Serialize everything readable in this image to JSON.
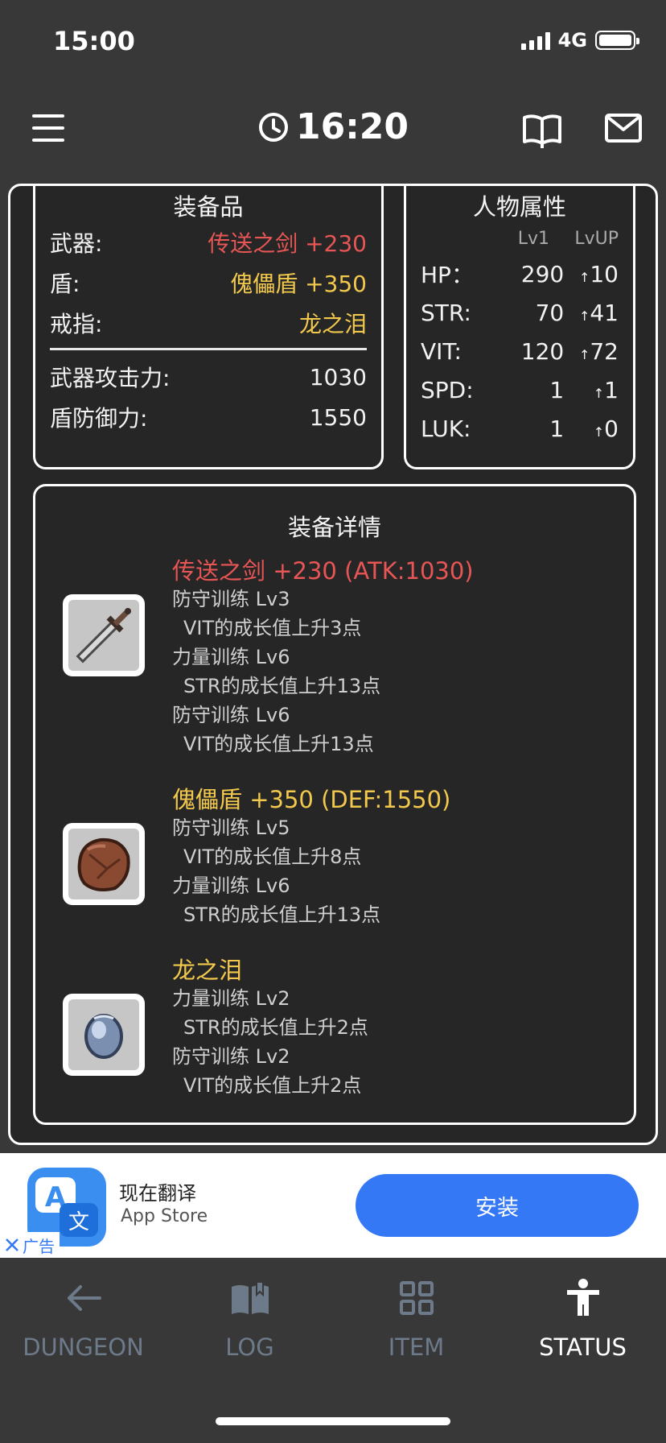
{
  "status_bar": {
    "time": "15:00",
    "network": "4G"
  },
  "header": {
    "game_time": "16:20"
  },
  "equipment": {
    "title": "装备品",
    "weapon_label": "武器:",
    "weapon_value": "传送之剑 +230",
    "shield_label": "盾:",
    "shield_value": "傀儡盾 +350",
    "ring_label": "戒指:",
    "ring_value": "龙之泪",
    "atk_label": "武器攻击力:",
    "atk_value": "1030",
    "def_label": "盾防御力:",
    "def_value": "1550"
  },
  "attributes": {
    "title": "人物属性",
    "col1": "Lv1",
    "col2": "LvUP",
    "rows": [
      {
        "key": "HP：",
        "base": "290",
        "up": "10"
      },
      {
        "key": "STR:",
        "base": "70",
        "up": "41"
      },
      {
        "key": "VIT:",
        "base": "120",
        "up": "72"
      },
      {
        "key": "SPD:",
        "base": "1",
        "up": "1"
      },
      {
        "key": "LUK:",
        "base": "1",
        "up": "0"
      }
    ]
  },
  "details": {
    "title": "装备详情",
    "items": [
      {
        "name": "传送之剑 +230 (ATK:1030)",
        "icon": "sword-icon",
        "lines": [
          "防守训练 Lv3",
          "VIT的成长值上升3点",
          "力量训练 Lv6",
          "STR的成长值上升13点",
          "防守训练 Lv6",
          "VIT的成长值上升13点"
        ]
      },
      {
        "name": "傀儡盾 +350 (DEF:1550)",
        "icon": "shield-icon",
        "lines": [
          "防守训练 Lv5",
          "VIT的成长值上升8点",
          "力量训练 Lv6",
          "STR的成长值上升13点"
        ]
      },
      {
        "name": "龙之泪",
        "icon": "gem-icon",
        "lines": [
          "力量训练 Lv2",
          "STR的成长值上升2点",
          "防守训练 Lv2",
          "VIT的成长值上升2点"
        ]
      }
    ]
  },
  "ad": {
    "title": "现在翻译",
    "subtitle": "App Store",
    "button": "安装",
    "tag": "广告"
  },
  "tabs": [
    {
      "label": "DUNGEON",
      "icon": "arrow-left-icon",
      "active": false
    },
    {
      "label": "LOG",
      "icon": "book-icon",
      "active": false
    },
    {
      "label": "ITEM",
      "icon": "grid-icon",
      "active": false
    },
    {
      "label": "STATUS",
      "icon": "person-icon",
      "active": true
    }
  ],
  "colors": {
    "red": "#e85555",
    "yellow": "#f2c94c",
    "accent_blue": "#3478f6"
  }
}
